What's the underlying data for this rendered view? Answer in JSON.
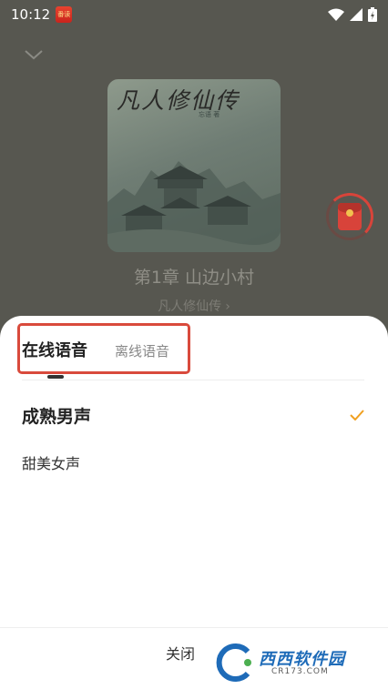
{
  "status_bar": {
    "time": "10:12",
    "app_icon_label": "番读"
  },
  "player": {
    "cover": {
      "title": "凡人修仙传",
      "subtitle": "忘语 著"
    },
    "chapter_title": "第1章 山边小村",
    "book_title": "凡人修仙传",
    "book_link_chevron": "›"
  },
  "sheet": {
    "tabs": [
      {
        "label": "在线语音",
        "selected": true
      },
      {
        "label": "离线语音",
        "selected": false
      }
    ],
    "voices": [
      {
        "label": "成熟男声",
        "selected": true
      },
      {
        "label": "甜美女声",
        "selected": false
      }
    ],
    "close_label": "关闭"
  },
  "watermark": {
    "text": "西西软件园",
    "sub": "CR173.COM"
  },
  "colors": {
    "accent": "#f0a020",
    "highlight_border": "#d94a3c",
    "player_bg": "#575750",
    "redpacket": "#d8433a"
  },
  "icons": [
    "chevron-down-icon",
    "wifi-icon",
    "signal-icon",
    "battery-icon",
    "red-packet-icon",
    "check-icon"
  ]
}
